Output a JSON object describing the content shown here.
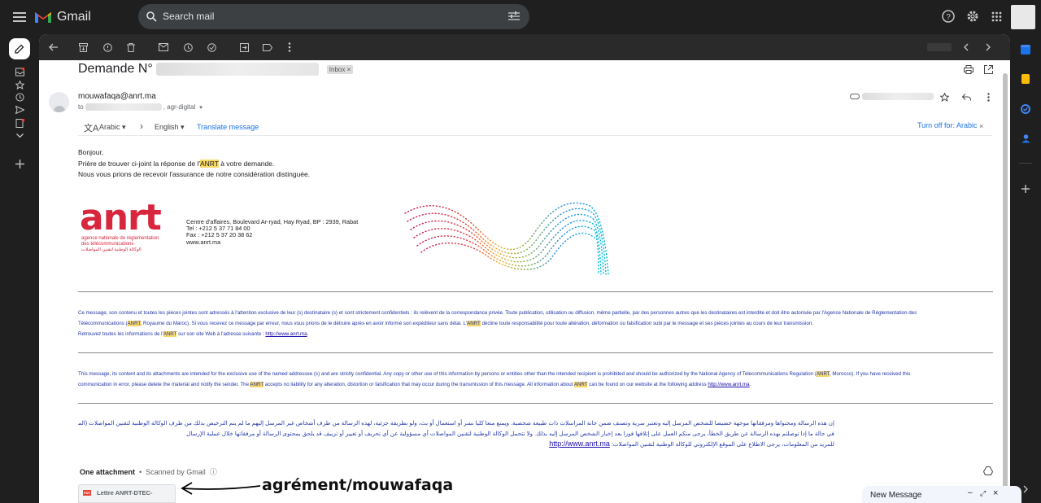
{
  "app": {
    "name": "Gmail"
  },
  "search": {
    "placeholder": "Search mail"
  },
  "icons": {
    "menu": "menu-icon",
    "gmail_logo": "gmail-logo-icon",
    "search": "search-icon",
    "filter": "tune-icon",
    "help": "help-icon",
    "settings": "gear-icon",
    "apps": "apps-grid-icon"
  },
  "email": {
    "subject_prefix": "Demande N°",
    "label_inbox": "Inbox",
    "sender": "mouwafaqa@anrt.ma",
    "to_prefix": "to",
    "to_suffix": ", agr-digital",
    "translate": {
      "from_lang": "Arabic",
      "to_lang": "English",
      "translate_link": "Translate message",
      "turn_off": "Turn off for: Arabic"
    },
    "body": {
      "greeting": "Bonjour,",
      "line1_pre": "Prière de trouver ci-joint la réponse de l'",
      "hl_anrt": "ANRT",
      "line1_post": " à votre demande.",
      "line2": "Nous vous prions de recevoir l'assurance de notre considération distinguée."
    },
    "signature": {
      "logo_text": "anrt",
      "logo_sub1": "agence nationale de réglementation",
      "logo_sub2": "des télécommunications",
      "logo_sub3": "الوكالة الوطنية لتقنين المواصلات",
      "addr1": "Centre d'affaires, Boulevard Ar-ryad, Hay Ryad, BP : 2939, Rabat",
      "tel": "Tel : +212 5 37 71 84 00",
      "fax": "Fax : +212 5 37 20 38 62",
      "web": "www.anrt.ma"
    },
    "disclaimer_fr": {
      "l1": "Ce message, son contenu et toutes les pièces jointes sont adressés à l'attention exclusive de leur (s) destinataire (s) et sont strictement confidentiels : ils relèvent de la correspondance privée. Toute publication, utilisation ou diffusion, même partielle, par des personnes autres que les destinataires est interdite et doit être autorisée par l'Agence Nationale de Réglementation des",
      "l2_pre": "Télécommunications (",
      "l2_post": ", Royaume du Maroc). Si vous recevez ce message par erreur, nous vous prions de le détruire après en avoir informé son expéditeur sans délai. L'",
      "l2_end": " décline toute responsabilité pour toute altération, déformation ou falsification subi par le message et ses pièces jointes au cours de leur transmission.",
      "l3_pre": "Retrouvez toutes les informations de l'",
      "l3_mid": " sur son site Web à l'adresse suivante : ",
      "l3_link": "http://www.anrt.ma",
      "l3_end": "."
    },
    "disclaimer_en": {
      "l1_pre": "This message, its content and its attachments are intended for the exclusive use of the named addressee (s) and are strictly confidential. Any copy or other use of this information by persons or entities other than the intended recipient is prohibited and should be authorized by the National Agency of Telecommunications Regulation (",
      "l1_post": ", Morocco). If you have received this",
      "l2_pre": "communication in error, please delete the material and notify the sender. The ",
      "l2_mid": " accepts no liability for any alteration, distortion or falsification that may occur during the transmission of this message. All information about ",
      "l2_mid2": " can be found on our website at the following address ",
      "l2_link": "http://www.anrt.ma",
      "l2_end": "."
    },
    "disclaimer_ar": {
      "l1": "إن هذه الرسالة ومحتواها ومرفقاتها موجهة خصيصا للشخص المرسل إليه وتعتبر سرية وتصنف ضمن خانة المراسلات ذات طبيعة شخصية. ويمنع منعا كليا نشر أو استعمال أو بث، ولو بطريقة جزئية، لهذه الرسالة من طرف أشخاص غير المرسل إليهم ما لم يتم الترخيص بذلك من طرف الوكالة الوطنية لتقنين المواصلات (المملكة المغربية",
      "l2": "في حالة ما إذا توصلتم بهذه الرسالة عن طريق الخطأ، يرجى منكم العمل على إتلافها فورا بعد إخبار الشخص المرسل إليه بذلك. ولا تتحمل الوكالة الوطنية لتقنين المواصلات أي مسؤولية عن أي تحريف أو تغيير أو تزييف قد يلحق بمحتوى الرسالة أو مرفقاتها خلال عملية الإرسال",
      "l3_pre": "للمزيد من المعلومات، يرجى الاطلاع على الموقع الإلكتروني للوكالة الوطنية لتقنين المواصلات: ",
      "l3_link": "http://www.anrt.ma"
    },
    "attachments": {
      "title": "One attachment",
      "scanned": "Scanned by Gmail",
      "file_name": "Lettre ANRT-DTEC-"
    }
  },
  "annotation": {
    "text": "agrément/mouwafaqa"
  },
  "compose": {
    "title": "New Message"
  }
}
